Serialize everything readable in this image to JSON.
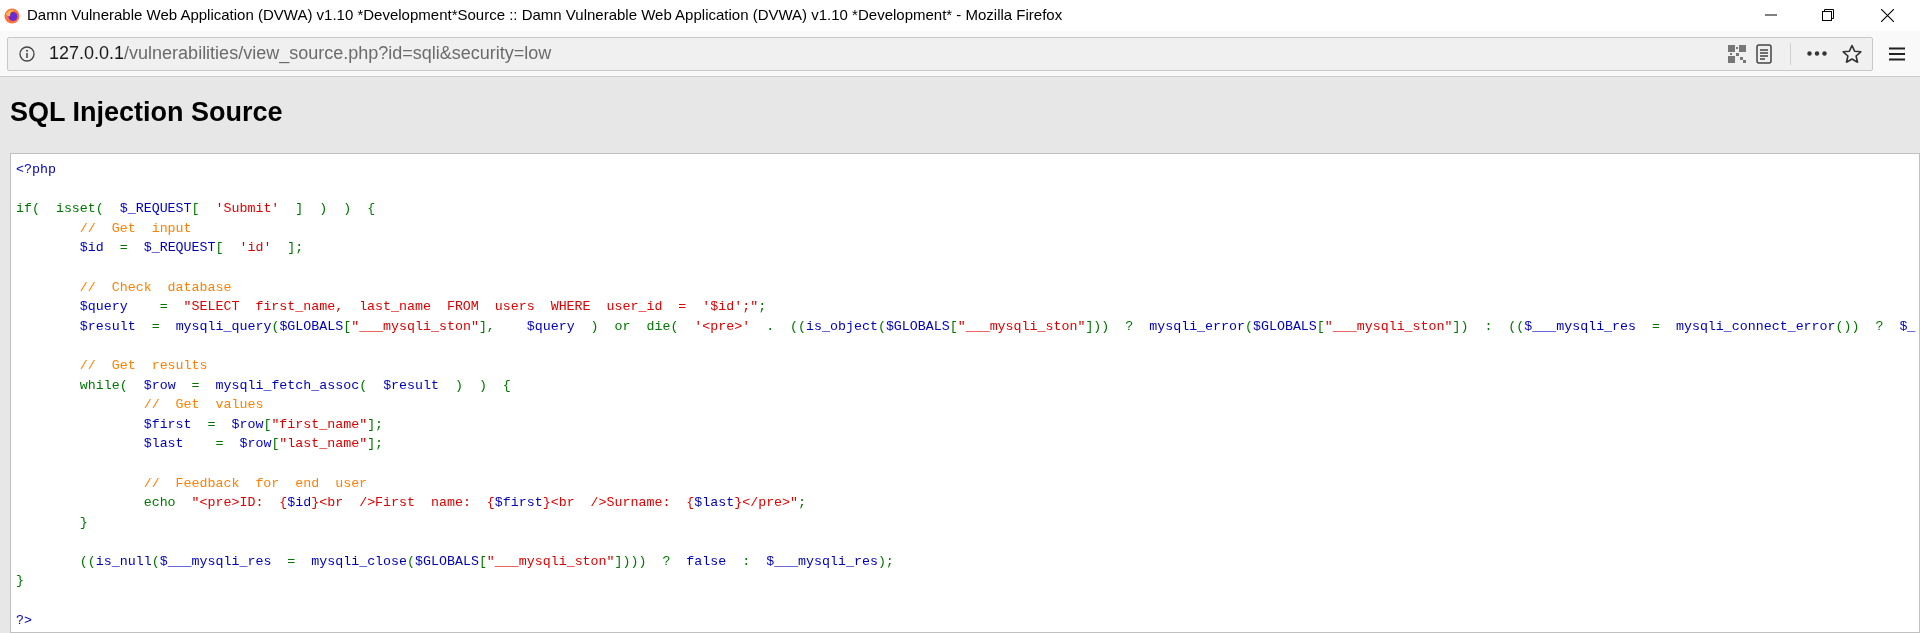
{
  "window": {
    "title": "Damn Vulnerable Web Application (DVWA) v1.10 *Development*Source :: Damn Vulnerable Web Application (DVWA) v1.10 *Development* - Mozilla Firefox"
  },
  "address_bar": {
    "host": "127.0.0.1",
    "path": "/vulnerabilities/view_source.php?id=sqli&security=low"
  },
  "page": {
    "heading": "SQL Injection Source",
    "code_lines": [
      {
        "kind": "code",
        "tokens": [
          {
            "kind": "default",
            "text": "<?php"
          }
        ]
      },
      {
        "kind": "blank"
      },
      {
        "kind": "code",
        "tokens": [
          {
            "kind": "keyword",
            "text": "if(  isset(  "
          },
          {
            "kind": "default",
            "text": "$_REQUEST"
          },
          {
            "kind": "keyword",
            "text": "[  "
          },
          {
            "kind": "string",
            "text": "'Submit'"
          },
          {
            "kind": "keyword",
            "text": "  ]  )  )  {"
          }
        ]
      },
      {
        "kind": "code",
        "tokens": [
          {
            "kind": "comment",
            "text": "\t//  Get  input"
          }
        ]
      },
      {
        "kind": "code",
        "tokens": [
          {
            "kind": "default",
            "text": "\t$id  "
          },
          {
            "kind": "keyword",
            "text": "=  "
          },
          {
            "kind": "default",
            "text": "$_REQUEST"
          },
          {
            "kind": "keyword",
            "text": "[  "
          },
          {
            "kind": "string",
            "text": "'id'"
          },
          {
            "kind": "keyword",
            "text": "  ];"
          }
        ]
      },
      {
        "kind": "blank"
      },
      {
        "kind": "code",
        "tokens": [
          {
            "kind": "comment",
            "text": "\t//  Check  database"
          }
        ]
      },
      {
        "kind": "code",
        "tokens": [
          {
            "kind": "default",
            "text": "\t$query    "
          },
          {
            "kind": "keyword",
            "text": "=  "
          },
          {
            "kind": "string",
            "text": "\"SELECT  first_name,  last_name  FROM  users  WHERE  user_id  =  '$id';\""
          },
          {
            "kind": "keyword",
            "text": ";"
          }
        ]
      },
      {
        "kind": "code",
        "tokens": [
          {
            "kind": "default",
            "text": "\t$result  "
          },
          {
            "kind": "keyword",
            "text": "=  "
          },
          {
            "kind": "default",
            "text": "mysqli_query"
          },
          {
            "kind": "keyword",
            "text": "("
          },
          {
            "kind": "default",
            "text": "$GLOBALS"
          },
          {
            "kind": "keyword",
            "text": "["
          },
          {
            "kind": "string",
            "text": "\"___mysqli_ston\""
          },
          {
            "kind": "keyword",
            "text": "],    "
          },
          {
            "kind": "default",
            "text": "$query  "
          },
          {
            "kind": "keyword",
            "text": ")  or  die(  "
          },
          {
            "kind": "string",
            "text": "'<pre>'  "
          },
          {
            "kind": "keyword",
            "text": ".  (("
          },
          {
            "kind": "default",
            "text": "is_object"
          },
          {
            "kind": "keyword",
            "text": "("
          },
          {
            "kind": "default",
            "text": "$GLOBALS"
          },
          {
            "kind": "keyword",
            "text": "["
          },
          {
            "kind": "string",
            "text": "\"___mysqli_ston\""
          },
          {
            "kind": "keyword",
            "text": "]))  ?  "
          },
          {
            "kind": "default",
            "text": "mysqli_error"
          },
          {
            "kind": "keyword",
            "text": "("
          },
          {
            "kind": "default",
            "text": "$GLOBALS"
          },
          {
            "kind": "keyword",
            "text": "["
          },
          {
            "kind": "string",
            "text": "\"___mysqli_ston\""
          },
          {
            "kind": "keyword",
            "text": "])  :  (("
          },
          {
            "kind": "default",
            "text": "$___mysqli_res  "
          },
          {
            "kind": "keyword",
            "text": "=  "
          },
          {
            "kind": "default",
            "text": "mysqli_connect_error"
          },
          {
            "kind": "keyword",
            "text": "())  ?  "
          },
          {
            "kind": "default",
            "text": "$_"
          }
        ]
      },
      {
        "kind": "blank"
      },
      {
        "kind": "code",
        "tokens": [
          {
            "kind": "comment",
            "text": "\t//  Get  results"
          }
        ]
      },
      {
        "kind": "code",
        "tokens": [
          {
            "kind": "keyword",
            "text": "\twhile(  "
          },
          {
            "kind": "default",
            "text": "$row  "
          },
          {
            "kind": "keyword",
            "text": "=  "
          },
          {
            "kind": "default",
            "text": "mysqli_fetch_assoc"
          },
          {
            "kind": "keyword",
            "text": "(  "
          },
          {
            "kind": "default",
            "text": "$result  "
          },
          {
            "kind": "keyword",
            "text": ")  )  {"
          }
        ]
      },
      {
        "kind": "code",
        "tokens": [
          {
            "kind": "comment",
            "text": "\t\t//  Get  values"
          }
        ]
      },
      {
        "kind": "code",
        "tokens": [
          {
            "kind": "default",
            "text": "\t\t$first  "
          },
          {
            "kind": "keyword",
            "text": "=  "
          },
          {
            "kind": "default",
            "text": "$row"
          },
          {
            "kind": "keyword",
            "text": "["
          },
          {
            "kind": "string",
            "text": "\"first_name\""
          },
          {
            "kind": "keyword",
            "text": "];"
          }
        ]
      },
      {
        "kind": "code",
        "tokens": [
          {
            "kind": "default",
            "text": "\t\t$last    "
          },
          {
            "kind": "keyword",
            "text": "=  "
          },
          {
            "kind": "default",
            "text": "$row"
          },
          {
            "kind": "keyword",
            "text": "["
          },
          {
            "kind": "string",
            "text": "\"last_name\""
          },
          {
            "kind": "keyword",
            "text": "];"
          }
        ]
      },
      {
        "kind": "blank"
      },
      {
        "kind": "code",
        "tokens": [
          {
            "kind": "comment",
            "text": "\t\t//  Feedback  for  end  user"
          }
        ]
      },
      {
        "kind": "code",
        "tokens": [
          {
            "kind": "keyword",
            "text": "\t\techo  "
          },
          {
            "kind": "string",
            "text": "\"<pre>ID:  {"
          },
          {
            "kind": "default",
            "text": "$id"
          },
          {
            "kind": "string",
            "text": "}<br  />First  name:  {"
          },
          {
            "kind": "default",
            "text": "$first"
          },
          {
            "kind": "string",
            "text": "}<br  />Surname:  {"
          },
          {
            "kind": "default",
            "text": "$last"
          },
          {
            "kind": "string",
            "text": "}</pre>\""
          },
          {
            "kind": "keyword",
            "text": ";"
          }
        ]
      },
      {
        "kind": "code",
        "tokens": [
          {
            "kind": "keyword",
            "text": "\t}"
          }
        ]
      },
      {
        "kind": "blank"
      },
      {
        "kind": "code",
        "tokens": [
          {
            "kind": "keyword",
            "text": "\t(("
          },
          {
            "kind": "default",
            "text": "is_null"
          },
          {
            "kind": "keyword",
            "text": "("
          },
          {
            "kind": "default",
            "text": "$___mysqli_res  "
          },
          {
            "kind": "keyword",
            "text": "=  "
          },
          {
            "kind": "default",
            "text": "mysqli_close"
          },
          {
            "kind": "keyword",
            "text": "("
          },
          {
            "kind": "default",
            "text": "$GLOBALS"
          },
          {
            "kind": "keyword",
            "text": "["
          },
          {
            "kind": "string",
            "text": "\"___mysqli_ston\""
          },
          {
            "kind": "keyword",
            "text": "])))  ?  "
          },
          {
            "kind": "default",
            "text": "false  "
          },
          {
            "kind": "keyword",
            "text": ":  "
          },
          {
            "kind": "default",
            "text": "$___mysqli_res"
          },
          {
            "kind": "keyword",
            "text": ");"
          }
        ]
      },
      {
        "kind": "code",
        "tokens": [
          {
            "kind": "keyword",
            "text": "}"
          }
        ]
      },
      {
        "kind": "blank"
      },
      {
        "kind": "code",
        "tokens": [
          {
            "kind": "default",
            "text": "?>"
          }
        ]
      }
    ]
  }
}
